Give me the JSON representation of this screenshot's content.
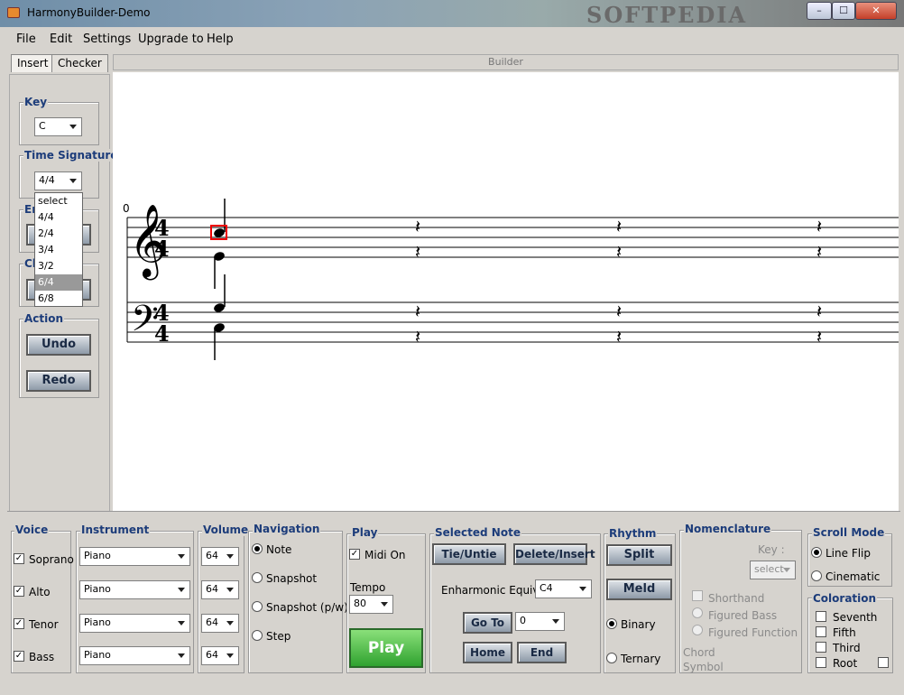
{
  "window": {
    "title": "HarmonyBuilder-Demo",
    "watermark": "SOFTPEDIA",
    "buttons": {
      "minimize": "–",
      "maximize": "☐",
      "close": "✕"
    }
  },
  "menu": [
    "File",
    "Edit",
    "Settings",
    "Upgrade to",
    "Help"
  ],
  "tabs": [
    "Insert",
    "Checker"
  ],
  "builder_label": "Builder",
  "left": {
    "key_label": "Key",
    "key_value": "C",
    "time_sig_label": "Time Signature",
    "time_sig_value": "4/4",
    "time_sig_options": [
      "select",
      "4/4",
      "2/4",
      "3/4",
      "3/2",
      "6/4",
      "6/8"
    ],
    "time_sig_highlighted": "6/4",
    "end_label": "En",
    "ch_label": "Ch",
    "action_label": "Action",
    "undo": "Undo",
    "redo": "Redo"
  },
  "score": {
    "measure_number": "0",
    "time_signature": "4/4",
    "clefs": [
      "treble",
      "bass"
    ]
  },
  "voice": {
    "label": "Voice",
    "items": [
      "Soprano",
      "Alto",
      "Tenor",
      "Bass"
    ],
    "checked": [
      true,
      true,
      true,
      true
    ]
  },
  "instrument": {
    "label": "Instrument",
    "values": [
      "Piano",
      "Piano",
      "Piano",
      "Piano"
    ]
  },
  "volume": {
    "label": "Volume",
    "values": [
      "64",
      "64",
      "64",
      "64"
    ]
  },
  "navigation": {
    "label": "Navigation",
    "items": [
      "Note",
      "Snapshot",
      "Snapshot (p/w)",
      "Step"
    ],
    "selected": "Note"
  },
  "play": {
    "label": "Play",
    "midi_on": "Midi On",
    "tempo_label": "Tempo",
    "tempo": "80",
    "play_button": "Play"
  },
  "selected_note": {
    "label": "Selected Note",
    "tie_untie": "Tie/Untie",
    "delete_insert": "Delete/Insert",
    "enharmonic_label": "Enharmonic Equiv.",
    "enharmonic_value": "C4",
    "goto": "Go To",
    "goto_value": "0",
    "home": "Home",
    "end": "End"
  },
  "rhythm": {
    "label": "Rhythm",
    "split": "Split",
    "meld": "Meld",
    "binary": "Binary",
    "ternary": "Ternary",
    "selected": "Binary"
  },
  "nomenclature": {
    "label": "Nomenclature",
    "key_label": "Key :",
    "key_value": "select",
    "shorthand": "Shorthand",
    "figured_bass": "Figured Bass",
    "figured_function": "Figured Function",
    "chord_symbol": "Chord\nSymbol"
  },
  "scroll_mode": {
    "label": "Scroll Mode",
    "line_flip": "Line Flip",
    "cinematic": "Cinematic",
    "selected": "Line Flip"
  },
  "coloration": {
    "label": "Coloration",
    "items": [
      "Seventh",
      "Fifth",
      "Third",
      "Root"
    ]
  }
}
